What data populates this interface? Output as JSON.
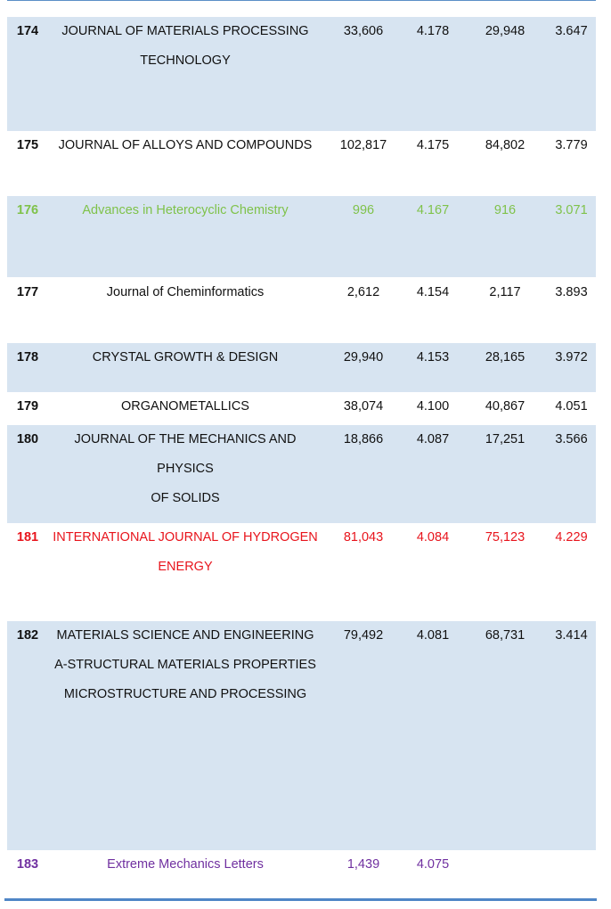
{
  "rows": [
    {
      "rank": "174",
      "title_lines": [
        "JOURNAL OF MATERIALS PROCESSING",
        "TECHNOLOGY"
      ],
      "v1": "33,606",
      "v2": "4.178",
      "v3": "29,948",
      "v4": "3.647"
    },
    {
      "rank": "175",
      "title_lines": [
        "JOURNAL OF ALLOYS AND COMPOUNDS"
      ],
      "v1": "102,817",
      "v2": "4.175",
      "v3": "84,802",
      "v4": "3.779"
    },
    {
      "rank": "176",
      "title_lines": [
        "Advances in Heterocyclic Chemistry"
      ],
      "v1": "996",
      "v2": "4.167",
      "v3": "916",
      "v4": "3.071"
    },
    {
      "rank": "177",
      "title_lines": [
        "Journal of Cheminformatics"
      ],
      "v1": "2,612",
      "v2": "4.154",
      "v3": "2,117",
      "v4": "3.893"
    },
    {
      "rank": "178",
      "title_lines": [
        "CRYSTAL GROWTH & DESIGN"
      ],
      "v1": "29,940",
      "v2": "4.153",
      "v3": "28,165",
      "v4": "3.972"
    },
    {
      "rank": "179",
      "title_lines": [
        "ORGANOMETALLICS"
      ],
      "v1": "38,074",
      "v2": "4.100",
      "v3": "40,867",
      "v4": "4.051"
    },
    {
      "rank": "180",
      "title_lines": [
        "JOURNAL OF THE MECHANICS AND PHYSICS",
        "OF SOLIDS"
      ],
      "v1": "18,866",
      "v2": "4.087",
      "v3": "17,251",
      "v4": "3.566"
    },
    {
      "rank": "181",
      "title_lines": [
        "INTERNATIONAL JOURNAL OF HYDROGEN",
        "ENERGY"
      ],
      "v1": "81,043",
      "v2": "4.084",
      "v3": "75,123",
      "v4": "4.229"
    },
    {
      "rank": "182",
      "title_lines": [
        "MATERIALS SCIENCE AND ENGINEERING",
        "A-STRUCTURAL MATERIALS PROPERTIES",
        "MICROSTRUCTURE AND PROCESSING"
      ],
      "v1": "79,492",
      "v2": "4.081",
      "v3": "68,731",
      "v4": "3.414"
    },
    {
      "rank": "183",
      "title_lines": [
        "Extreme Mechanics Letters"
      ],
      "v1": "1,439",
      "v2": "4.075",
      "v3": "",
      "v4": ""
    }
  ],
  "colors": {
    "row_fill": "#d7e4f1",
    "rule": "#4f86c6",
    "highlight_green": "#7fc24a",
    "highlight_red": "#e8141c",
    "highlight_purple": "#7030a0"
  }
}
